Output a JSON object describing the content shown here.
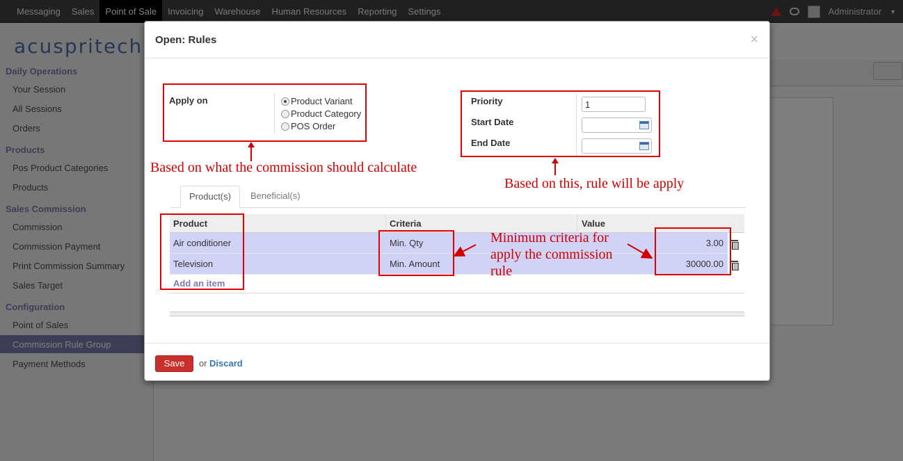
{
  "topbar": {
    "menu": [
      "Messaging",
      "Sales",
      "Point of Sale",
      "Invoicing",
      "Warehouse",
      "Human Resources",
      "Reporting",
      "Settings"
    ],
    "active": "Point of Sale",
    "user": "Administrator"
  },
  "sidebar": {
    "logo": "acuspritech",
    "sections": {
      "daily": "Daily Operations",
      "products": "Products",
      "commission": "Sales Commission",
      "config": "Configuration"
    },
    "items": {
      "your_session": "Your Session",
      "all_sessions": "All Sessions",
      "orders": "Orders",
      "pos_categories": "Pos Product Categories",
      "products": "Products",
      "commission": "Commission",
      "commission_payment": "Commission Payment",
      "print_summary": "Print Commission Summary",
      "sales_target": "Sales Target",
      "point_of_sales": "Point of Sales",
      "rule_group": "Commission Rule Group",
      "payment_methods": "Payment Methods"
    }
  },
  "modal": {
    "title": "Open: Rules",
    "close": "×",
    "apply_on": {
      "label": "Apply on",
      "options": [
        "Product Variant",
        "Product Category",
        "POS Order"
      ],
      "selected": "Product Variant"
    },
    "priority": {
      "label": "Priority",
      "value": "1"
    },
    "start_date": {
      "label": "Start Date",
      "value": ""
    },
    "end_date": {
      "label": "End Date",
      "value": ""
    },
    "tabs": [
      "Product(s)",
      "Beneficial(s)"
    ],
    "active_tab": "Product(s)",
    "grid": {
      "columns": [
        "Product",
        "Criteria",
        "Value"
      ],
      "rows": [
        {
          "product": "Air conditioner",
          "criteria": "Min. Qty",
          "value": "3.00"
        },
        {
          "product": "Television",
          "criteria": "Min. Amount",
          "value": "30000.00"
        }
      ],
      "add_item": "Add an item"
    },
    "footer": {
      "save": "Save",
      "or": "or",
      "discard": "Discard"
    }
  },
  "annotations": {
    "apply_on": "Based on what the commission should calculate",
    "dates": "Based on this, rule will be apply",
    "criteria": [
      "Minimum criteria for",
      "apply the commission",
      "rule"
    ]
  }
}
